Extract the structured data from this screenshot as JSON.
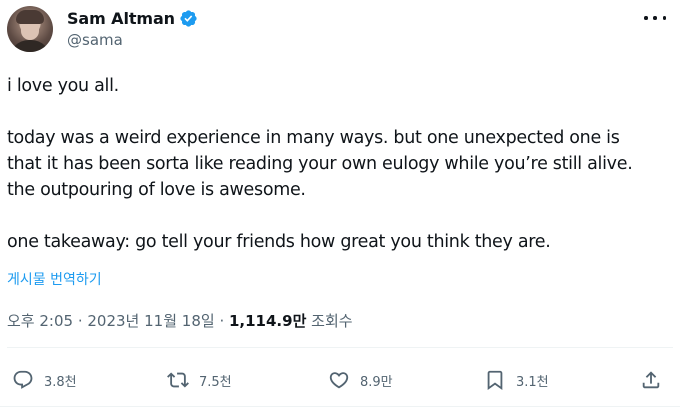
{
  "author": {
    "display_name": "Sam Altman",
    "handle": "@sama",
    "verified": true
  },
  "tweet": {
    "paragraphs": [
      [
        "i love you all."
      ],
      [
        "today was a weird experience in many ways. but one unexpected one is",
        "that it has been sorta like reading your own eulogy while you’re still alive.",
        "the outpouring of love is awesome."
      ],
      [
        "one takeaway: go tell your friends how great you think they are."
      ]
    ],
    "translate_label": "게시물 번역하기"
  },
  "meta": {
    "time": "오후 2:05",
    "separator": " · ",
    "date": "2023년 11월 18일",
    "views_count": "1,114.9만",
    "views_label": "조회수"
  },
  "actions": {
    "replies": "3.8천",
    "reposts": "7.5천",
    "likes": "8.9만",
    "bookmarks": "3.1천"
  },
  "colors": {
    "accent": "#1d9bf0",
    "text": "#0f1419",
    "secondary": "#536471"
  },
  "icons": {
    "verified": "verified-badge-icon",
    "more": "more-icon",
    "reply": "reply-icon",
    "repost": "repost-icon",
    "like": "heart-icon",
    "bookmark": "bookmark-icon",
    "share": "share-icon"
  }
}
